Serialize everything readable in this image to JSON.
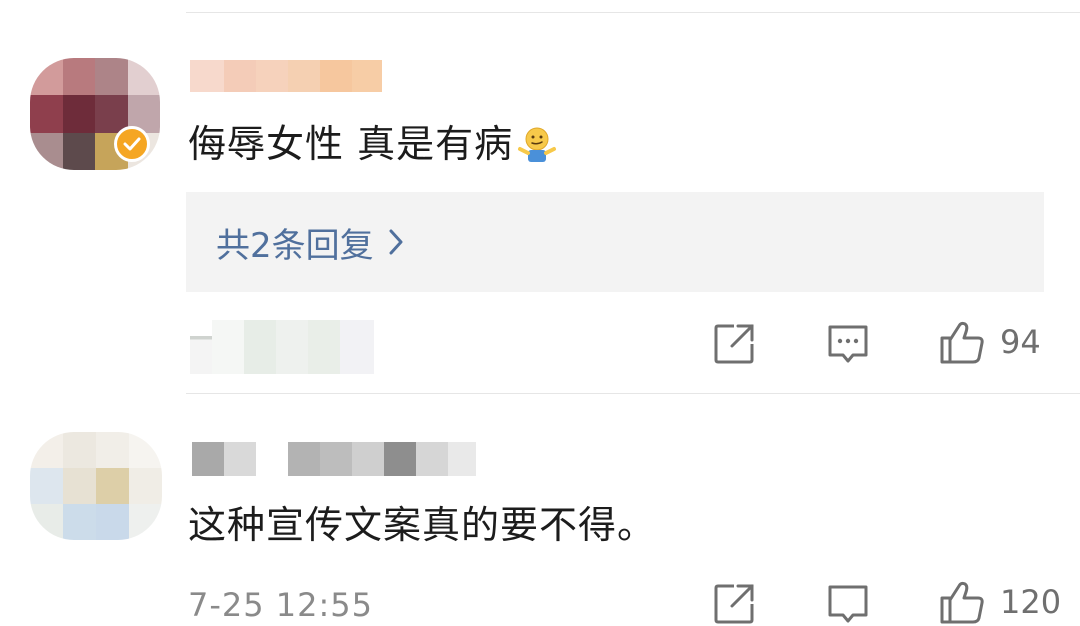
{
  "comments": [
    {
      "text": "侮辱女性 真是有病",
      "emoji": "shrug-emoji",
      "reply_link": "共2条回复",
      "like_count": "94",
      "verified": true
    },
    {
      "text": "这种宣传文案真的要不得。",
      "timestamp": "7-25 12:55",
      "like_count": "120"
    }
  ],
  "colors": {
    "reply_link": "#50709d",
    "verified_badge": "#f5a623",
    "icon": "#6f6f6f",
    "divider": "#e6e6e6",
    "reply_bg": "#f3f3f3"
  }
}
